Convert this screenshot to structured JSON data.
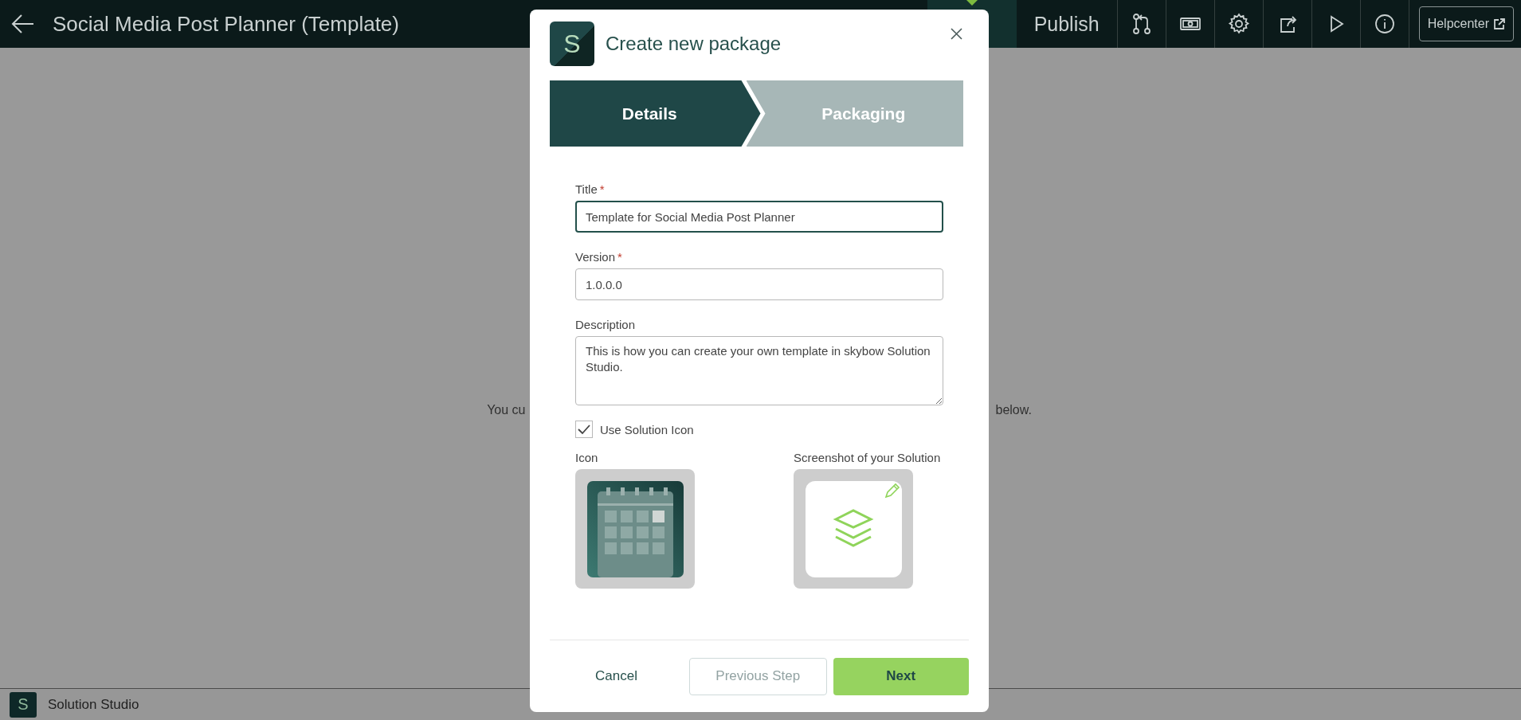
{
  "topbar": {
    "title": "Social Media Post Planner (Template)",
    "publish": "Publish",
    "helpcenter": "Helpcenter"
  },
  "background": {
    "text_left": "You cu",
    "text_right": "below."
  },
  "footer": {
    "logo": "S",
    "app_name": "Solution Studio"
  },
  "dialog": {
    "logo": "S",
    "title": "Create new package",
    "required_mark": "*",
    "steps": [
      {
        "label": "Details",
        "selected": true
      },
      {
        "label": "Packaging",
        "selected": false
      }
    ],
    "fields": [
      {
        "kind": "input",
        "label": "Title",
        "required": true,
        "focused": true,
        "value": "Template for Social Media Post Planner"
      },
      {
        "kind": "input",
        "label": "Version",
        "required": true,
        "focused": false,
        "value": "1.0.0.0"
      },
      {
        "kind": "textarea",
        "label": "Description",
        "required": false,
        "focused": false,
        "value": "This is how you can create your own template in skybow Solution Studio."
      }
    ],
    "use_solution_icon": {
      "label": "Use Solution Icon",
      "checked": true
    },
    "images": [
      {
        "label": "Icon",
        "kind": "calendar",
        "editable": false
      },
      {
        "label": "Screenshot of your Solution",
        "kind": "placeholder",
        "editable": true
      }
    ],
    "buttons": [
      {
        "label": "Cancel",
        "kind": "link",
        "disabled": false
      },
      {
        "label": "Previous Step",
        "kind": "secondary",
        "disabled": true
      },
      {
        "label": "Next",
        "kind": "primary",
        "disabled": false
      }
    ]
  }
}
